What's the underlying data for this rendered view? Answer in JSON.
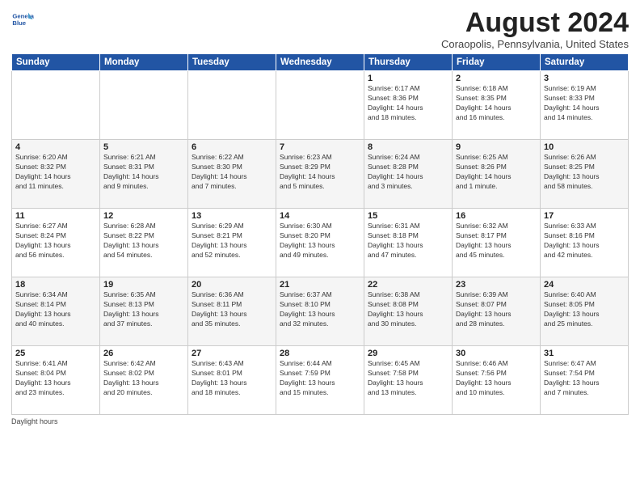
{
  "header": {
    "logo_line1": "General",
    "logo_line2": "Blue",
    "title": "August 2024",
    "subtitle": "Coraopolis, Pennsylvania, United States"
  },
  "weekdays": [
    "Sunday",
    "Monday",
    "Tuesday",
    "Wednesday",
    "Thursday",
    "Friday",
    "Saturday"
  ],
  "weeks": [
    [
      {
        "day": "",
        "info": ""
      },
      {
        "day": "",
        "info": ""
      },
      {
        "day": "",
        "info": ""
      },
      {
        "day": "",
        "info": ""
      },
      {
        "day": "1",
        "info": "Sunrise: 6:17 AM\nSunset: 8:36 PM\nDaylight: 14 hours\nand 18 minutes."
      },
      {
        "day": "2",
        "info": "Sunrise: 6:18 AM\nSunset: 8:35 PM\nDaylight: 14 hours\nand 16 minutes."
      },
      {
        "day": "3",
        "info": "Sunrise: 6:19 AM\nSunset: 8:33 PM\nDaylight: 14 hours\nand 14 minutes."
      }
    ],
    [
      {
        "day": "4",
        "info": "Sunrise: 6:20 AM\nSunset: 8:32 PM\nDaylight: 14 hours\nand 11 minutes."
      },
      {
        "day": "5",
        "info": "Sunrise: 6:21 AM\nSunset: 8:31 PM\nDaylight: 14 hours\nand 9 minutes."
      },
      {
        "day": "6",
        "info": "Sunrise: 6:22 AM\nSunset: 8:30 PM\nDaylight: 14 hours\nand 7 minutes."
      },
      {
        "day": "7",
        "info": "Sunrise: 6:23 AM\nSunset: 8:29 PM\nDaylight: 14 hours\nand 5 minutes."
      },
      {
        "day": "8",
        "info": "Sunrise: 6:24 AM\nSunset: 8:28 PM\nDaylight: 14 hours\nand 3 minutes."
      },
      {
        "day": "9",
        "info": "Sunrise: 6:25 AM\nSunset: 8:26 PM\nDaylight: 14 hours\nand 1 minute."
      },
      {
        "day": "10",
        "info": "Sunrise: 6:26 AM\nSunset: 8:25 PM\nDaylight: 13 hours\nand 58 minutes."
      }
    ],
    [
      {
        "day": "11",
        "info": "Sunrise: 6:27 AM\nSunset: 8:24 PM\nDaylight: 13 hours\nand 56 minutes."
      },
      {
        "day": "12",
        "info": "Sunrise: 6:28 AM\nSunset: 8:22 PM\nDaylight: 13 hours\nand 54 minutes."
      },
      {
        "day": "13",
        "info": "Sunrise: 6:29 AM\nSunset: 8:21 PM\nDaylight: 13 hours\nand 52 minutes."
      },
      {
        "day": "14",
        "info": "Sunrise: 6:30 AM\nSunset: 8:20 PM\nDaylight: 13 hours\nand 49 minutes."
      },
      {
        "day": "15",
        "info": "Sunrise: 6:31 AM\nSunset: 8:18 PM\nDaylight: 13 hours\nand 47 minutes."
      },
      {
        "day": "16",
        "info": "Sunrise: 6:32 AM\nSunset: 8:17 PM\nDaylight: 13 hours\nand 45 minutes."
      },
      {
        "day": "17",
        "info": "Sunrise: 6:33 AM\nSunset: 8:16 PM\nDaylight: 13 hours\nand 42 minutes."
      }
    ],
    [
      {
        "day": "18",
        "info": "Sunrise: 6:34 AM\nSunset: 8:14 PM\nDaylight: 13 hours\nand 40 minutes."
      },
      {
        "day": "19",
        "info": "Sunrise: 6:35 AM\nSunset: 8:13 PM\nDaylight: 13 hours\nand 37 minutes."
      },
      {
        "day": "20",
        "info": "Sunrise: 6:36 AM\nSunset: 8:11 PM\nDaylight: 13 hours\nand 35 minutes."
      },
      {
        "day": "21",
        "info": "Sunrise: 6:37 AM\nSunset: 8:10 PM\nDaylight: 13 hours\nand 32 minutes."
      },
      {
        "day": "22",
        "info": "Sunrise: 6:38 AM\nSunset: 8:08 PM\nDaylight: 13 hours\nand 30 minutes."
      },
      {
        "day": "23",
        "info": "Sunrise: 6:39 AM\nSunset: 8:07 PM\nDaylight: 13 hours\nand 28 minutes."
      },
      {
        "day": "24",
        "info": "Sunrise: 6:40 AM\nSunset: 8:05 PM\nDaylight: 13 hours\nand 25 minutes."
      }
    ],
    [
      {
        "day": "25",
        "info": "Sunrise: 6:41 AM\nSunset: 8:04 PM\nDaylight: 13 hours\nand 23 minutes."
      },
      {
        "day": "26",
        "info": "Sunrise: 6:42 AM\nSunset: 8:02 PM\nDaylight: 13 hours\nand 20 minutes."
      },
      {
        "day": "27",
        "info": "Sunrise: 6:43 AM\nSunset: 8:01 PM\nDaylight: 13 hours\nand 18 minutes."
      },
      {
        "day": "28",
        "info": "Sunrise: 6:44 AM\nSunset: 7:59 PM\nDaylight: 13 hours\nand 15 minutes."
      },
      {
        "day": "29",
        "info": "Sunrise: 6:45 AM\nSunset: 7:58 PM\nDaylight: 13 hours\nand 13 minutes."
      },
      {
        "day": "30",
        "info": "Sunrise: 6:46 AM\nSunset: 7:56 PM\nDaylight: 13 hours\nand 10 minutes."
      },
      {
        "day": "31",
        "info": "Sunrise: 6:47 AM\nSunset: 7:54 PM\nDaylight: 13 hours\nand 7 minutes."
      }
    ]
  ],
  "footer": {
    "label": "Daylight hours"
  }
}
